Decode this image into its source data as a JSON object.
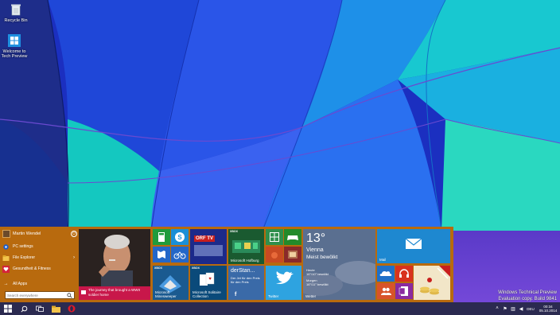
{
  "desktop": {
    "icons": [
      {
        "label": "Recycle Bin",
        "icon": "recycle-bin-icon"
      },
      {
        "label": "Welcome to Tech Preview",
        "icon": "windows-logo-icon"
      }
    ]
  },
  "start_menu": {
    "background": "#b86a0e",
    "user": {
      "name": "Martin Wendel"
    },
    "items": [
      {
        "label": "PC settings",
        "icon": "gear-icon"
      },
      {
        "label": "File Explorer",
        "icon": "folder-icon",
        "arrow": "›"
      },
      {
        "label": "Gesundheit & Fitness",
        "icon": "heart-icon"
      },
      {
        "label": "All Apps",
        "icon": "arrow-right-icon"
      }
    ],
    "search": {
      "placeholder": "Search everywhere"
    }
  },
  "tiles": {
    "news_caption": "The journey that brought a WWII soldier home",
    "xbox_label": "XBOX",
    "drf_label": "ORF TVthek",
    "drf_logo": "ORF TV",
    "hofburg_label": "Microsoft Hofburg",
    "solitaire_label": "Microsoft Solitaire Collection",
    "minesweeper_label": "Microsoft Minesweeper",
    "derstandard_title": "derStan...",
    "derstandard_text": "Der Jet für den Preis für den Preis",
    "twitter_label": "Twitter",
    "weather": {
      "temp": "13°",
      "city": "Vienna",
      "condition": "Meist bewölkt",
      "today_label": "Heute",
      "today_value": "16°/10° bewölkt",
      "tomorrow_label": "Morgen",
      "tomorrow_value": "16°/11° bewölkt",
      "app_label": "Wetter"
    },
    "mail_label": "Mail"
  },
  "watermark": {
    "line1": "Windows Technical Preview",
    "line2": "Evaluation copy. Build 9841"
  },
  "taskbar": {
    "lang": "DEU",
    "time": "00:34",
    "date": "05.10.2014"
  },
  "colors": {
    "taskbar": "#2b2a50",
    "start_menu": "#b86a0e",
    "mail_tile": "#1e88d0",
    "twitter_tile": "#2ea3e0",
    "news_tile": "#c8174a"
  }
}
